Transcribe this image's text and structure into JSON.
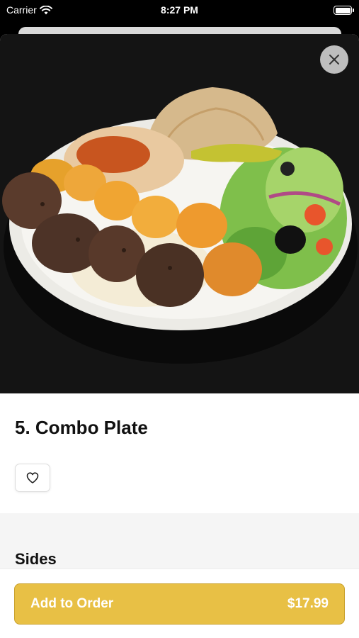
{
  "status_bar": {
    "carrier": "Carrier",
    "time": "8:27 PM",
    "icons": [
      "wifi-icon",
      "battery-icon"
    ]
  },
  "item": {
    "name": "5. Combo Plate",
    "image": "combo-plate-photo",
    "favorite_icon": "heart-icon",
    "close_icon": "close-icon"
  },
  "sections": {
    "sides_heading": "Sides"
  },
  "footer": {
    "add_label": "Add to Order",
    "price": "$17.99"
  },
  "colors": {
    "accent": "#E8C045",
    "background": "#FFFFFF",
    "section_bg": "#F5F5F5"
  }
}
